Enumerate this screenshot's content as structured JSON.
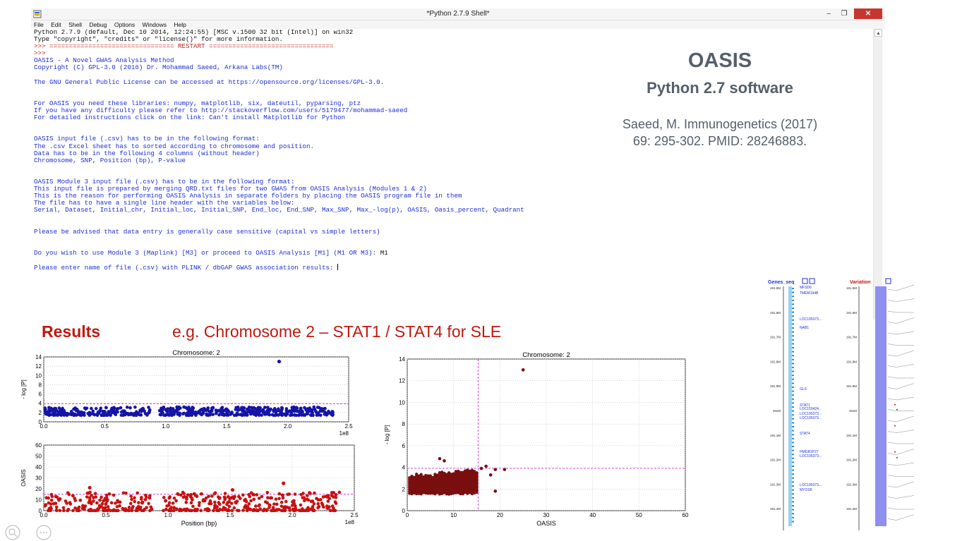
{
  "window": {
    "title": "*Python 2.7.9 Shell*",
    "controls": {
      "minimize": "–",
      "maximize": "❐",
      "close": "✕"
    }
  },
  "menu": [
    "File",
    "Edit",
    "Shell",
    "Debug",
    "Options",
    "Windows",
    "Help"
  ],
  "console": {
    "lines": [
      {
        "text": "Python 2.7.9 (default, Dec 10 2014, 12:24:55) [MSC v.1500 32 bit (Intel)] on win32",
        "color": "k"
      },
      {
        "text": "Type \"copyright\", \"credits\" or \"license()\" for more information.",
        "color": "k"
      },
      {
        "text": ">>> ================================ RESTART ================================",
        "color": "r"
      },
      {
        "text": ">>>",
        "color": "r"
      },
      {
        "text": "OASIS - A Novel GWAS Analysis Method",
        "color": "b"
      },
      {
        "text": "Copyright (C) GPL-3.0 (2016) Dr. Mohammad Saeed, Arkana Labs(TM)",
        "color": "b"
      },
      {
        "text": "",
        "color": "b"
      },
      {
        "text": "The GNU General Public License can be accessed at https://opensource.org/licenses/GPL-3.0.",
        "color": "b"
      },
      {
        "text": "",
        "color": "b"
      },
      {
        "text": "",
        "color": "b"
      },
      {
        "text": "For OASIS you need these libraries: numpy, matplotlib, six, dateutil, pyparsing, ptz",
        "color": "b"
      },
      {
        "text": "If you have any difficulty please refer to http://stackoverflow.com/users/5179477/mohammad-saeed",
        "color": "b"
      },
      {
        "text": "For detailed instructions click on the link: Can't install Matplotlib for Python",
        "color": "b"
      },
      {
        "text": "",
        "color": "b"
      },
      {
        "text": "",
        "color": "b"
      },
      {
        "text": "OASIS input file (.csv) has to be in the following format:",
        "color": "b"
      },
      {
        "text": "The .csv Excel sheet has to sorted according to chromosome and position.",
        "color": "b"
      },
      {
        "text": "Data has to be in the following 4 columns (without header)",
        "color": "b"
      },
      {
        "text": "Chromosome, SNP, Position (bp), P-value",
        "color": "b"
      },
      {
        "text": "",
        "color": "b"
      },
      {
        "text": "",
        "color": "b"
      },
      {
        "text": "OASIS Module 3 input file (.csv) has to be in the following format:",
        "color": "b"
      },
      {
        "text": "This input file is prepared by merging QRD.txt files for two GWAS from OASIS Analysis (Modules 1 & 2)",
        "color": "b"
      },
      {
        "text": "This is the reason for performing OASIS Analysis in separate folders by placing the OASIS program file in them",
        "color": "b"
      },
      {
        "text": "The file has to have a single line header with the variables below:",
        "color": "b"
      },
      {
        "text": "Serial, Dataset, Initial_chr, Initial_loc, Initial_SNP, End_loc, End_SNP, Max_SNP, Max_-log(p), OASIS, Oasis_percent, Quadrant",
        "color": "b"
      },
      {
        "text": "",
        "color": "b"
      },
      {
        "text": "",
        "color": "b"
      },
      {
        "text": "Please be advised that data entry is generally case sensitive (capital vs simple letters)",
        "color": "b"
      },
      {
        "text": "",
        "color": "b"
      },
      {
        "text": "",
        "color": "b"
      },
      {
        "text": "Do you wish to use Module 3 (Maplink) [M3] or proceed to OASIS Analysis [M1] (M1 OR M3): ",
        "color": "b",
        "input": "M1"
      },
      {
        "text": "",
        "color": "b"
      },
      {
        "text": "Please enter name of file (.csv) with PLINK / dbGAP GWAS association results: ",
        "color": "b",
        "cursor": true
      }
    ]
  },
  "overlay": {
    "title": "OASIS",
    "subtitle": "Python 2.7 software",
    "citation_line1": "Saeed, M. Immunogenetics (2017)",
    "citation_line2": "69: 295-302. PMID: 28246883.",
    "results_label": "Results",
    "results_example": "e.g. Chromosome 2 – STAT1 / STAT4 for SLE"
  },
  "chart_data": [
    {
      "type": "scatter",
      "title": "Chromosome: 2",
      "xlabel": "",
      "ylabel": "- log [P]",
      "xlim": [
        0.0,
        2.5
      ],
      "ylim": [
        0,
        14
      ],
      "x_scale_label": "1e8",
      "xticks": [
        0.0,
        0.5,
        1.0,
        1.5,
        2.0,
        2.5
      ],
      "yticks": [
        0,
        2,
        4,
        6,
        8,
        10,
        12,
        14
      ],
      "threshold": 3.9,
      "grid": true,
      "color": "#1414a8",
      "highlight": [
        {
          "x": 1.93,
          "y": 13.0
        }
      ],
      "band": {
        "center": 2.1,
        "spread": 1.0,
        "npoints": 600
      }
    },
    {
      "type": "scatter",
      "title": "",
      "xlabel": "Position (bp)",
      "ylabel": "OASIS",
      "xlim": [
        0.0,
        2.5
      ],
      "ylim": [
        0,
        60
      ],
      "x_scale_label": "1e8",
      "xticks": [
        0.0,
        0.5,
        1.0,
        1.5,
        2.0,
        2.5
      ],
      "yticks": [
        0,
        10,
        20,
        30,
        40,
        50,
        60
      ],
      "threshold": 15,
      "grid": true,
      "color": "#c81010",
      "highlight": [
        {
          "x": 1.93,
          "y": 25.0
        },
        {
          "x": 0.37,
          "y": 21.0
        },
        {
          "x": 1.52,
          "y": 19.0
        }
      ],
      "band": {
        "center": 6,
        "spread": 10,
        "npoints": 500
      }
    },
    {
      "type": "scatter",
      "title": "Chromosome: 2",
      "xlabel": "OASIS",
      "ylabel": "- log [P]",
      "xlim": [
        0,
        60
      ],
      "ylim": [
        0,
        14
      ],
      "xticks": [
        0,
        10,
        20,
        30,
        40,
        50,
        60
      ],
      "yticks": [
        0,
        2,
        4,
        6,
        8,
        10,
        12,
        14
      ],
      "hline": 3.9,
      "vline": 15.3,
      "grid": true,
      "color": "#7a0f0f",
      "points": [
        [
          25,
          13.0
        ],
        [
          7,
          4.8
        ],
        [
          8,
          4.6
        ],
        [
          17,
          4.1
        ],
        [
          19,
          3.8
        ],
        [
          16,
          3.9
        ],
        [
          18,
          3.3
        ],
        [
          19,
          1.8
        ],
        [
          21,
          3.8
        ],
        [
          13,
          3.6
        ]
      ],
      "columns": {
        "xmin": 0,
        "xmax": 15,
        "ymin": 1.5,
        "ymax": 3.6
      }
    }
  ],
  "genome_browser": {
    "track1_title": "Genes_seq",
    "track2_title": "Variation",
    "positions": [
      "191.5M",
      "191.6M",
      "191.7M",
      "191.8M",
      "191.9M",
      "191M",
      "191.1M",
      "191.2M",
      "191.3M",
      "191.4M"
    ],
    "genes": [
      "MFSD6",
      "TMEM194B",
      "LOC195373...",
      "NAB1",
      "GLS",
      "STAT1",
      "LOC150424...",
      "LOC195373...",
      "LOC195373...",
      "STAT4",
      "HMGB1P27",
      "LOC195373...",
      "LOC195373...",
      "MYO1B"
    ]
  },
  "colors": {
    "accent_red": "#c0180f",
    "heading_gray": "#555f6a",
    "shell_blue": "#1d2fd8",
    "shell_red": "#c0241b"
  }
}
